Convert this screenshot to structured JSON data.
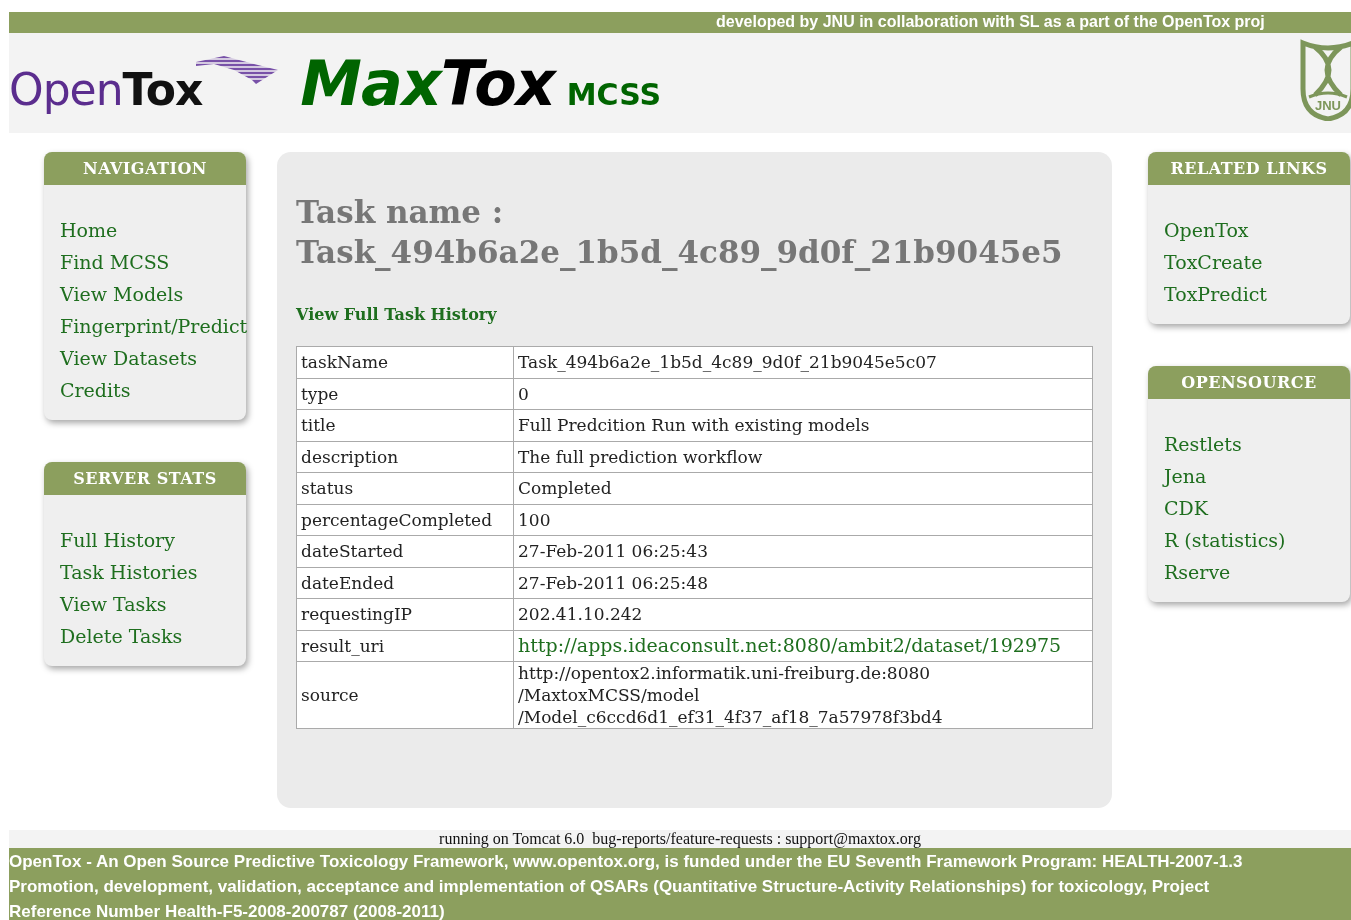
{
  "banner": "developed by JNU in collaboration with SL as a part of the OpenTox proj",
  "header": {
    "logo_open": "Open",
    "logo_tox": "Tox",
    "title_max": "Max",
    "title_tox": "Tox",
    "title_suffix": "MCSS",
    "emblem_text": "JNU"
  },
  "left_boxes": [
    {
      "title": "NAVIGATION",
      "links": [
        "Home",
        "Find MCSS",
        "View Models",
        "Fingerprint/Predict",
        "View Datasets",
        "Credits"
      ]
    },
    {
      "title": "SERVER STATS",
      "links": [
        "Full History",
        "Task Histories",
        "View Tasks",
        "Delete Tasks"
      ]
    }
  ],
  "task": {
    "heading_label": "Task name :",
    "heading_value": "Task_494b6a2e_1b5d_4c89_9d0f_21b9045e5",
    "history_link": "View Full Task History",
    "rows": [
      {
        "key": "taskName",
        "kind": "text",
        "lines": [
          "Task_494b6a2e_1b5d_4c89_9d0f_21b9045e5c07"
        ]
      },
      {
        "key": "type",
        "kind": "text",
        "lines": [
          "0"
        ]
      },
      {
        "key": "title",
        "kind": "text",
        "lines": [
          "Full Predcition Run with existing models"
        ]
      },
      {
        "key": "description",
        "kind": "text",
        "lines": [
          "The full prediction workflow"
        ]
      },
      {
        "key": "status",
        "kind": "text",
        "lines": [
          "Completed"
        ]
      },
      {
        "key": "percentageCompleted",
        "kind": "text",
        "lines": [
          "100"
        ]
      },
      {
        "key": "dateStarted",
        "kind": "text",
        "lines": [
          "27-Feb-2011 06:25:43"
        ]
      },
      {
        "key": "dateEnded",
        "kind": "text",
        "lines": [
          "27-Feb-2011 06:25:48"
        ]
      },
      {
        "key": "requestingIP",
        "kind": "text",
        "lines": [
          "202.41.10.242"
        ]
      },
      {
        "key": "result_uri",
        "kind": "link",
        "lines": [
          "http://apps.ideaconsult.net:8080/ambit2/dataset/192975"
        ]
      },
      {
        "key": "source",
        "kind": "text",
        "lines": [
          "http://opentox2.informatik.uni-freiburg.de:8080",
          "/MaxtoxMCSS/model",
          "/Model_c6ccd6d1_ef31_4f37_af18_7a57978f3bd4"
        ]
      }
    ]
  },
  "right_boxes": [
    {
      "title": "RELATED LINKS",
      "links": [
        "OpenTox",
        "ToxCreate",
        "ToxPredict"
      ]
    },
    {
      "title": "OPENSOURCE",
      "links": [
        "Restlets",
        "Jena",
        "CDK",
        "R (statistics)",
        "Rserve"
      ]
    }
  ],
  "footer": {
    "server_line": "running on Tomcat 6.0  bug-reports/feature-requests : support@maxtox.org",
    "funding_lines": [
      "OpenTox - An Open Source Predictive Toxicology Framework, www.opentox.org, is funded under the EU Seventh Framework Program: HEALTH-2007-1.3",
      "Promotion, development, validation, acceptance and implementation of QSARs (Quantitative Structure-Activity Relationships) for toxicology, Project",
      "Reference Number Health-F5-2008-200787 (2008-2011)"
    ]
  }
}
